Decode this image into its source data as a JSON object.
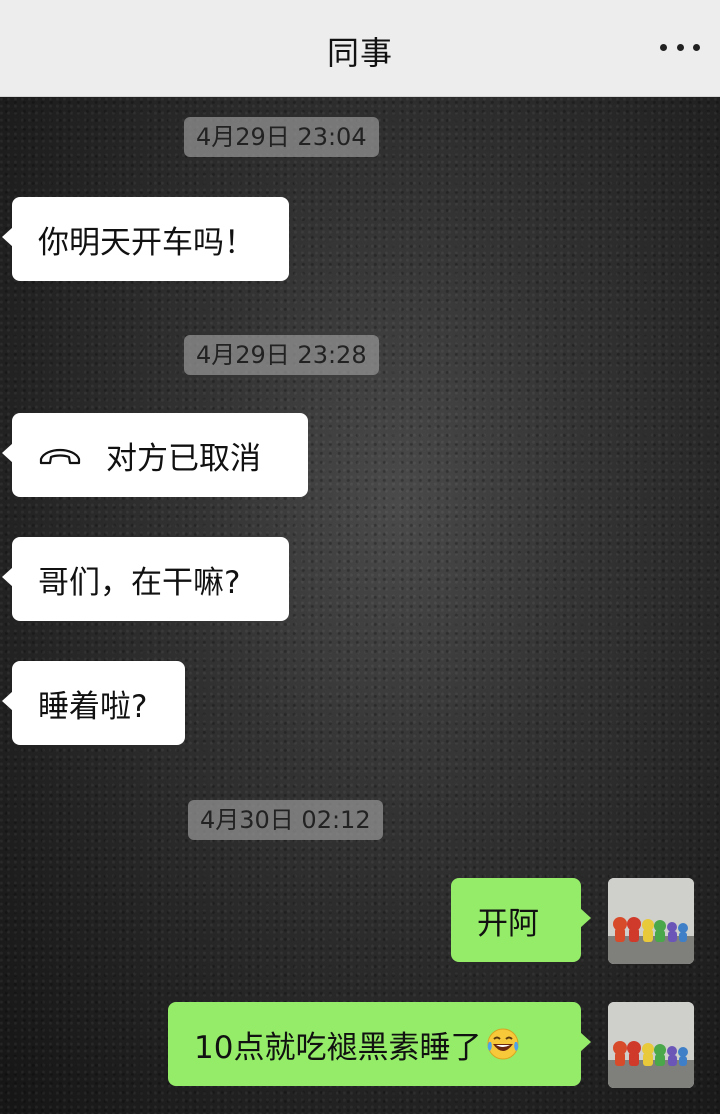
{
  "header": {
    "title": "同事",
    "more_icon": "more-icon"
  },
  "colors": {
    "incoming_bubble": "#ffffff",
    "outgoing_bubble": "#95ec69",
    "header_bg": "#ededed"
  },
  "messages": [
    {
      "type": "time",
      "text": "4月29日 23:04"
    },
    {
      "type": "incoming",
      "text": "你明天开车吗！"
    },
    {
      "type": "time",
      "text": "4月29日 23:28"
    },
    {
      "type": "incoming-call",
      "icon": "phone-hangup-icon",
      "text": "对方已取消"
    },
    {
      "type": "incoming",
      "text": "哥们，在干嘛?"
    },
    {
      "type": "incoming",
      "text": "睡着啦?"
    },
    {
      "type": "time",
      "text": "4月30日 02:12"
    },
    {
      "type": "outgoing",
      "text": "开阿"
    },
    {
      "type": "outgoing",
      "text": "10点就吃褪黑素睡了",
      "emoji": "laughing-tears-emoji"
    }
  ]
}
